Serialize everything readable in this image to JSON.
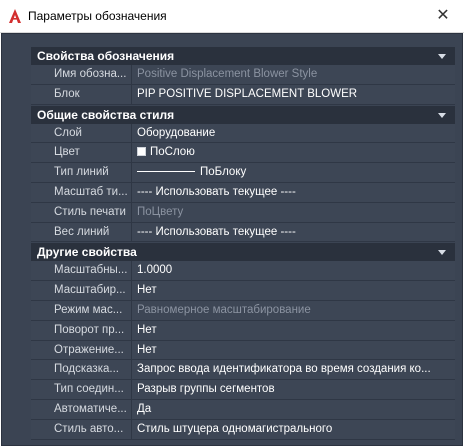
{
  "window": {
    "title": "Параметры обозначения",
    "close_glyph": "✕",
    "logo_color": "#d32f2f"
  },
  "sections": [
    {
      "header": "Свойства обозначения",
      "rows": [
        {
          "name": "Имя обозна...",
          "value": "Positive Displacement Blower Style",
          "dim": true
        },
        {
          "name": "Блок",
          "value": "PIP POSITIVE DISPLACEMENT BLOWER",
          "dim": false
        }
      ]
    },
    {
      "header": "Общие свойства стиля",
      "rows": [
        {
          "name": "Слой",
          "value": "Оборудование",
          "dim": false
        },
        {
          "name": "Цвет",
          "value": "ПоСлою",
          "dim": false,
          "swatch": "#ffffff"
        },
        {
          "name": "Тип линий",
          "value": "ПоБлоку",
          "dim": false,
          "line": true
        },
        {
          "name": "Масштаб ти...",
          "value": "---- Использовать текущее ----",
          "dim": false
        },
        {
          "name": "Стиль печати",
          "value": "ПоЦвету",
          "dim": true
        },
        {
          "name": "Вес линий",
          "value": "---- Использовать текущее ----",
          "dim": false
        }
      ]
    },
    {
      "header": "Другие свойства",
      "rows": [
        {
          "name": "Масштабны...",
          "value": "1.0000",
          "dim": false
        },
        {
          "name": "Масштабир...",
          "value": "Нет",
          "dim": false
        },
        {
          "name": "Режим мас...",
          "value": "Равномерное масштабирование",
          "dim": true
        },
        {
          "name": "Поворот пр...",
          "value": "Нет",
          "dim": false
        },
        {
          "name": "Отражение...",
          "value": "Нет",
          "dim": false
        },
        {
          "name": "Подсказка...",
          "value": "Запрос ввода идентификатора во время создания ко...",
          "dim": false
        },
        {
          "name": "Тип соедин...",
          "value": "Разрыв группы сегментов",
          "dim": false
        },
        {
          "name": "Автоматиче...",
          "value": "Да",
          "dim": false
        },
        {
          "name": "Стиль авто...",
          "value": "Стиль штуцера одномагистрального",
          "dim": false
        }
      ]
    }
  ],
  "colors": {
    "panel_bg": "#3b4453",
    "header_bg": "#2a313d",
    "text": "#ffffff",
    "dim_text": "#8b93a1"
  }
}
